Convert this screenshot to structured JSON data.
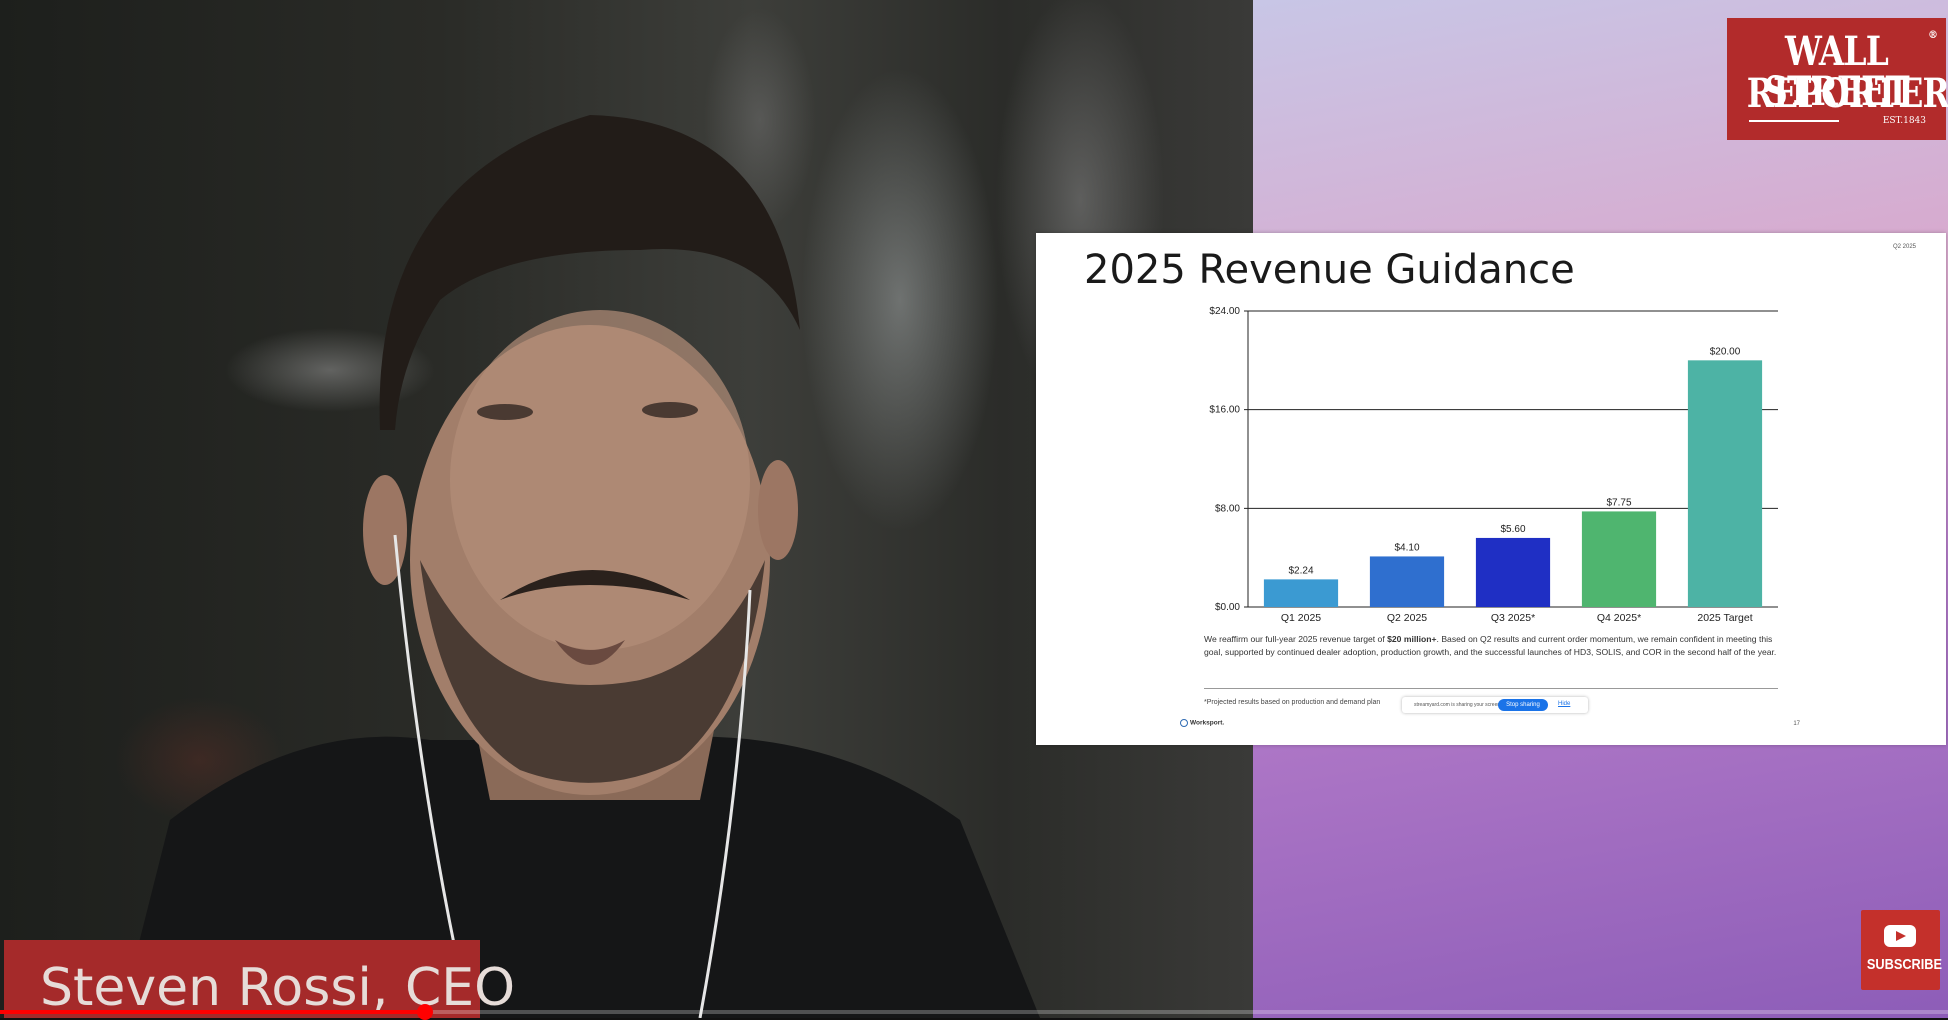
{
  "logo": {
    "line1": "WALL STREET",
    "line2": "REPORTER",
    "est": "EST.1843",
    "reg": "®"
  },
  "slide": {
    "title": "2025 Revenue Guidance",
    "tag": "Q2 2025",
    "body": [
      {
        "t": "We reaffirm our full-year 2025 revenue target of ",
        "b": false
      },
      {
        "t": "$20 million+",
        "b": true
      },
      {
        "t": ". Based on Q2 results and current order momentum, we remain confident in meeting this goal, supported by continued dealer adoption, production growth, and the successful launches of HD3, SOLIS, and COR in the second half of the year.",
        "b": false
      }
    ],
    "footnote": "*Projected results based on production and demand plan",
    "share_text": "streamyard.com is sharing your screen.",
    "stop_label": "Stop sharing",
    "hide_label": "Hide",
    "brand": "Worksport.",
    "page": "17"
  },
  "chart_data": {
    "type": "bar",
    "categories": [
      "Q1 2025",
      "Q2 2025",
      "Q3 2025*",
      "Q4 2025*",
      "2025 Target"
    ],
    "values": [
      2.24,
      4.1,
      5.6,
      7.75,
      20.0
    ],
    "value_labels": [
      "$2.24",
      "$4.10",
      "$5.60",
      "$7.75",
      "$20.00"
    ],
    "colors": [
      "#3b9ad2",
      "#2f6fcf",
      "#1f2fc4",
      "#4fb56f",
      "#4db3a5"
    ],
    "ylim": [
      0,
      24
    ],
    "yticks": [
      0,
      8,
      16,
      24
    ],
    "ytick_labels": [
      "$0.00",
      "$8.00",
      "$16.00",
      "$24.00"
    ],
    "grid": true,
    "title": "",
    "xlabel": "",
    "ylabel": ""
  },
  "lower_third": {
    "name": "Steven Rossi, CEO"
  },
  "player": {
    "progress": 0.218
  },
  "subscribe": {
    "label": "SUBSCRIBE",
    "icon": "youtube-play-icon"
  }
}
